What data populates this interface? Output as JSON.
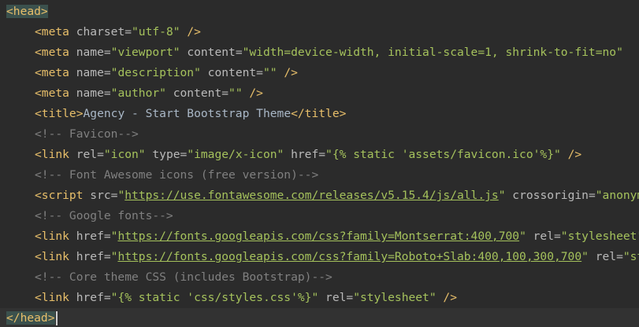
{
  "editor": {
    "language": "html",
    "colors": {
      "background": "#2b2b2b",
      "tag": "#e8bf6a",
      "attribute": "#bababa",
      "string": "#a5c25c",
      "text": "#a9b7c6",
      "comment": "#808080",
      "bracket_match": "#3b514d",
      "current_line": "#323232"
    },
    "lines": [
      {
        "tag_open": "<head>"
      },
      {
        "tag": "<meta",
        "a1": " charset=",
        "v1": "\"utf-8\"",
        "end": " />"
      },
      {
        "tag": "<meta",
        "a1": " name=",
        "v1": "\"viewport\"",
        "a2": " content=",
        "v2": "\"width=device-width, initial-scale=1, shrink-to-fit=no\""
      },
      {
        "tag": "<meta",
        "a1": " name=",
        "v1": "\"description\"",
        "a2": " content=",
        "v2": "\"\"",
        "end": " />"
      },
      {
        "tag": "<meta",
        "a1": " name=",
        "v1": "\"author\"",
        "a2": " content=",
        "v2": "\"\"",
        "end": " />"
      },
      {
        "tag_open": "<title>",
        "text": "Agency - Start Bootstrap Theme",
        "tag_close": "</title>"
      },
      {
        "comment": "<!-- Favicon-->"
      },
      {
        "tag": "<link",
        "a1": " rel=",
        "v1": "\"icon\"",
        "a2": " type=",
        "v2": "\"image/x-icon\"",
        "a3": " href=",
        "v3": "\"{% static 'assets/favicon.ico'%}\"",
        "end": " />"
      },
      {
        "comment": "<!-- Font Awesome icons (free version)-->"
      },
      {
        "tag": "<script",
        "a1": " src=",
        "q1": "\"",
        "u1": "https://use.fontawesome.com/releases/v5.15.4/js/all.js",
        "q2": "\"",
        "a2": " crossorigin=",
        "v2": "\"anonymous\""
      },
      {
        "comment": "<!-- Google fonts-->"
      },
      {
        "tag": "<link",
        "a1": " href=",
        "q1": "\"",
        "u1": "https://fonts.googleapis.com/css?family=Montserrat:400,700",
        "q2": "\"",
        "a2": " rel=",
        "v2": "\"stylesheet\""
      },
      {
        "tag": "<link",
        "a1": " href=",
        "q1": "\"",
        "u1": "https://fonts.googleapis.com/css?family=Roboto+Slab:400,100,300,700",
        "q2": "\"",
        "a2": " rel=",
        "v2": "\"stylesheet\""
      },
      {
        "comment": "<!-- Core theme CSS (includes Bootstrap)-->"
      },
      {
        "tag": "<link",
        "a1": " href=",
        "v1": "\"{% static 'css/styles.css'%}\"",
        "a2": " rel=",
        "v2": "\"stylesheet\"",
        "end": " />"
      },
      {
        "tag_close": "</head>"
      }
    ]
  }
}
